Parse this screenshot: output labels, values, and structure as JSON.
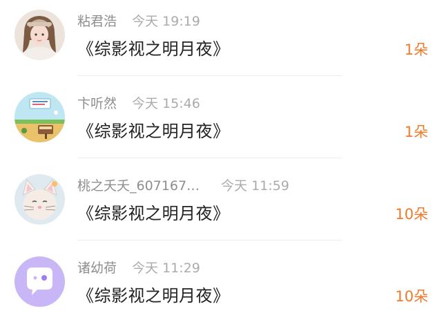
{
  "gift_list": {
    "items": [
      {
        "user_name": "粘君浩",
        "time": "今天 19:19",
        "title": "《综影视之明月夜》",
        "count": "1朵",
        "avatar_icon": "girl-photo-avatar"
      },
      {
        "user_name": "卞听然",
        "time": "今天 15:46",
        "title": "《综影视之明月夜》",
        "count": "1朵",
        "avatar_icon": "cartoon-landscape-avatar"
      },
      {
        "user_name": "桃之夭夭_607167…",
        "time": "今天 11:59",
        "title": "《综影视之明月夜》",
        "count": "10朵",
        "avatar_icon": "cat-baby-avatar"
      },
      {
        "user_name": "诸幼荷",
        "time": "今天 11:29",
        "title": "《综影视之明月夜》",
        "count": "10朵",
        "avatar_icon": "default-chat-bubble-avatar"
      }
    ]
  },
  "colors": {
    "count_accent": "#f07a2a",
    "name_gray": "#8e8e8e",
    "time_gray": "#ababab",
    "title_text": "#222222",
    "default_avatar_purple": "#c9b6f7"
  }
}
